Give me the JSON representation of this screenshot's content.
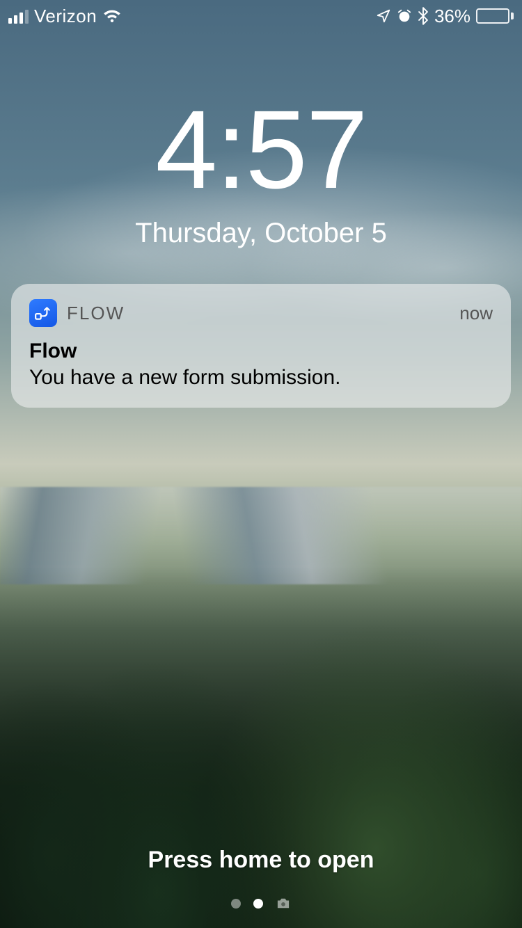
{
  "status_bar": {
    "carrier": "Verizon",
    "signal_active_bars": 3,
    "battery_percent_label": "36%",
    "battery_fill_pct": 36
  },
  "clock": {
    "time": "4:57",
    "date": "Thursday, October 5"
  },
  "notification": {
    "app_label": "FLOW",
    "timestamp": "now",
    "title": "Flow",
    "message": "You have a new form submission."
  },
  "unlock_hint": "Press home to open"
}
